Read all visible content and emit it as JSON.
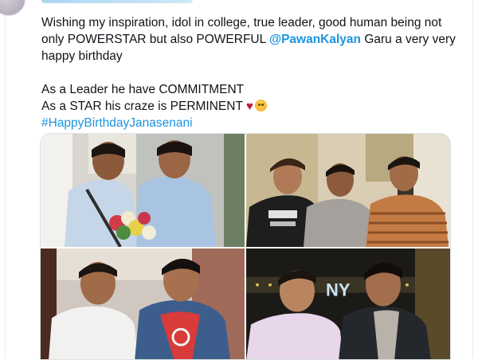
{
  "tweet": {
    "lines": [
      {
        "before": "Wishing my inspiration, idol in college, true leader, good human being not only POWERSTAR but also POWERFUL ",
        "mention": "@PawanKalyan",
        "after": " Garu a very very happy birthday"
      }
    ],
    "leader_line": "As a Leader he have COMMITMENT",
    "star_line": "As a STAR his craze is PERMINENT",
    "hashtag": "#HappyBirthdayJanasenani"
  },
  "media": {
    "photos": [
      {
        "name": "photo-1"
      },
      {
        "name": "photo-2"
      },
      {
        "name": "photo-3"
      },
      {
        "name": "photo-4"
      }
    ],
    "photo4_sign": "NY"
  },
  "colors": {
    "link": "#1b95e0",
    "text": "#0f1419",
    "heart": "#be1931"
  }
}
